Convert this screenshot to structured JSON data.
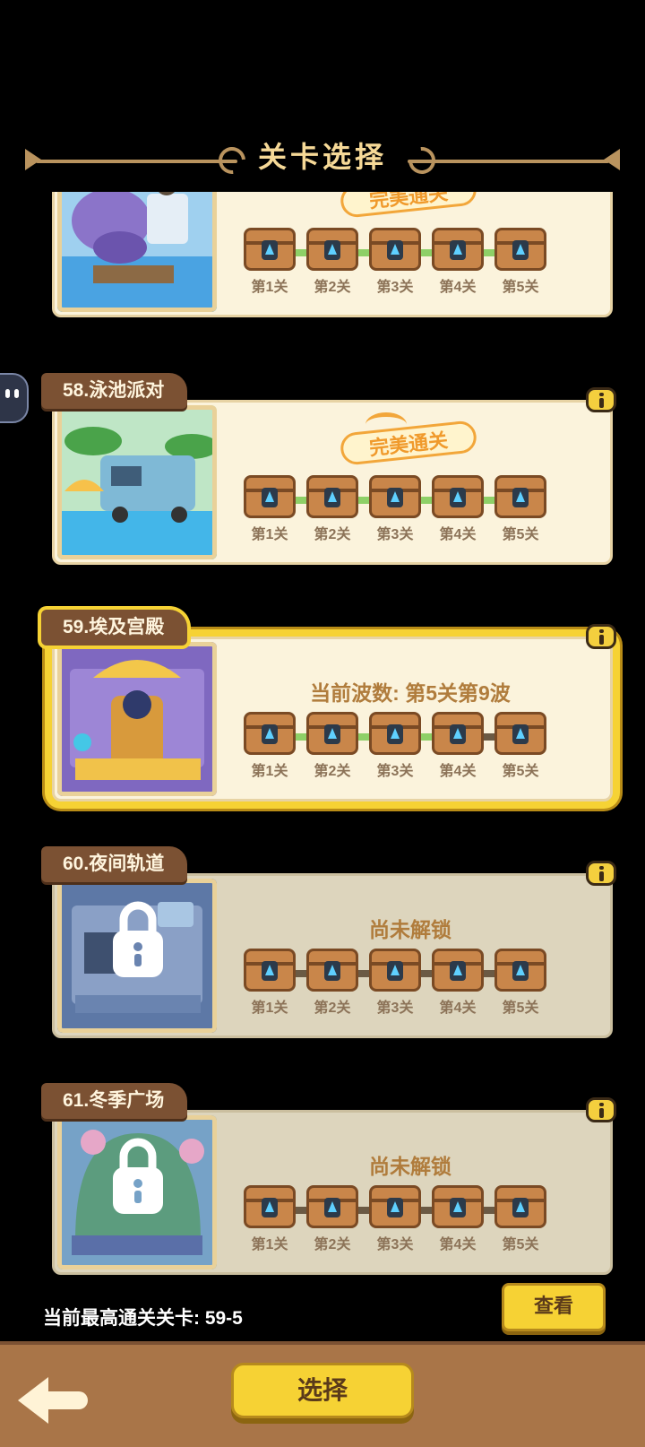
{
  "header": {
    "title": "关卡选择"
  },
  "levels": [
    {
      "name": "",
      "status": "完美通关",
      "state": "perfect",
      "chests": [
        "第1关",
        "第2关",
        "第3关",
        "第4关",
        "第5关"
      ]
    },
    {
      "name": "58.泳池派对",
      "status": "完美通关",
      "state": "perfect",
      "chests": [
        "第1关",
        "第2关",
        "第3关",
        "第4关",
        "第5关"
      ]
    },
    {
      "name": "59.埃及宫殿",
      "status": "当前波数: 第5关第9波",
      "state": "current",
      "chests": [
        "第1关",
        "第2关",
        "第3关",
        "第4关",
        "第5关"
      ]
    },
    {
      "name": "60.夜间轨道",
      "status": "尚未解锁",
      "state": "locked",
      "chests": [
        "第1关",
        "第2关",
        "第3关",
        "第4关",
        "第5关"
      ]
    },
    {
      "name": "61.冬季广场",
      "status": "尚未解锁",
      "state": "locked",
      "chests": [
        "第1关",
        "第2关",
        "第3关",
        "第4关",
        "第5关"
      ]
    }
  ],
  "best": {
    "label": "当前最高通关关卡: 59-5"
  },
  "buttons": {
    "view": "查看",
    "select": "选择"
  },
  "icons": {
    "info": "info-icon",
    "back": "back-arrow-icon",
    "lock": "lock-icon",
    "chest": "treasure-chest-icon"
  },
  "colors": {
    "accent": "#f6d234",
    "panel": "#fbf3dc",
    "plate": "#7b5133",
    "track_done": "#8ed067"
  }
}
